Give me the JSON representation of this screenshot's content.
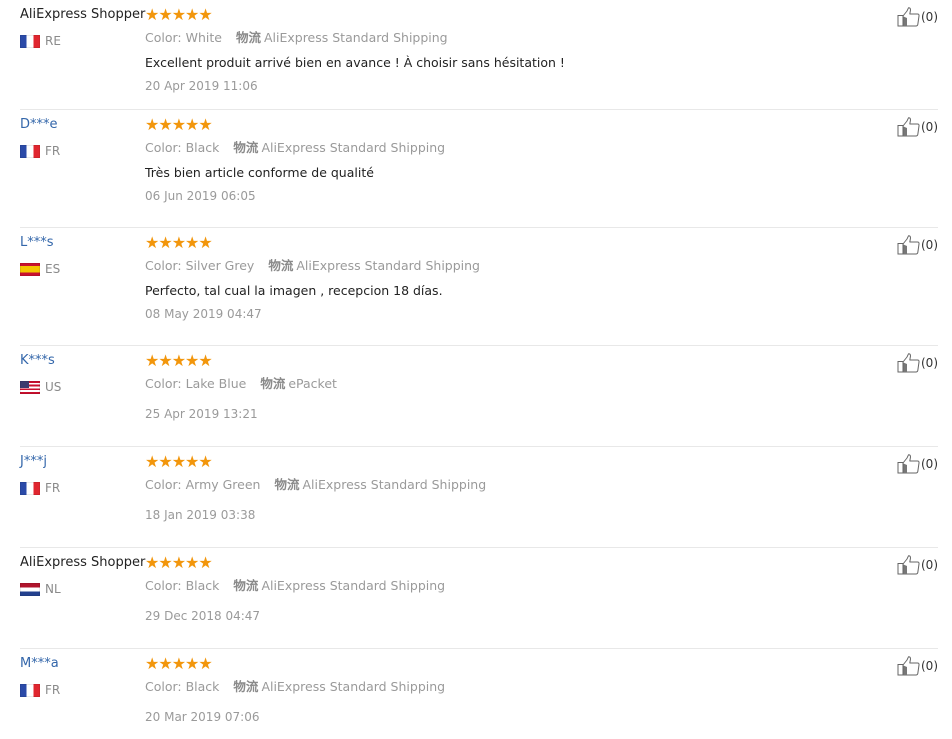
{
  "shipping_label": "物流",
  "star_color": "#f2960c",
  "reviews": [
    {
      "user": "AliExpress Shopper",
      "country": "RE",
      "flag": "fr",
      "stars": "★★★★★",
      "rating": 5,
      "color": "Color: White",
      "shipping": "AliExpress Standard Shipping",
      "text": "Excellent produit arrivé bien en avance ! À choisir sans hésitation !",
      "date": "20 Apr 2019 11:06",
      "helpful": "(0)"
    },
    {
      "user": "D***e",
      "country": "FR",
      "flag": "fr",
      "stars": "★★★★★",
      "rating": 5,
      "color": "Color: Black",
      "shipping": "AliExpress Standard Shipping",
      "text": "Très bien article conforme de qualité",
      "date": "06 Jun 2019 06:05",
      "helpful": "(0)"
    },
    {
      "user": "L***s",
      "country": "ES",
      "flag": "es",
      "stars": "★★★★★",
      "rating": 5,
      "color": "Color: Silver Grey",
      "shipping": "AliExpress Standard Shipping",
      "text": "Perfecto, tal cual la imagen , recepcion 18 días.",
      "date": "08 May 2019 04:47",
      "helpful": "(0)"
    },
    {
      "user": "K***s",
      "country": "US",
      "flag": "us",
      "stars": "★★★★★",
      "rating": 5,
      "color": "Color: Lake Blue",
      "shipping": "ePacket",
      "text": "",
      "date": "25 Apr 2019 13:21",
      "helpful": "(0)"
    },
    {
      "user": "J***j",
      "country": "FR",
      "flag": "fr",
      "stars": "★★★★★",
      "rating": 5,
      "color": "Color: Army Green",
      "shipping": "AliExpress Standard Shipping",
      "text": "",
      "date": "18 Jan 2019 03:38",
      "helpful": "(0)"
    },
    {
      "user": "AliExpress Shopper",
      "country": "NL",
      "flag": "nl",
      "stars": "★★★★★",
      "rating": 5,
      "color": "Color: Black",
      "shipping": "AliExpress Standard Shipping",
      "text": "",
      "date": "29 Dec 2018 04:47",
      "helpful": "(0)"
    },
    {
      "user": "M***a",
      "country": "FR",
      "flag": "fr",
      "stars": "★★★★★",
      "rating": 5,
      "color": "Color: Black",
      "shipping": "AliExpress Standard Shipping",
      "text": "",
      "date": "20 Mar 2019 07:06",
      "helpful": "(0)"
    }
  ]
}
